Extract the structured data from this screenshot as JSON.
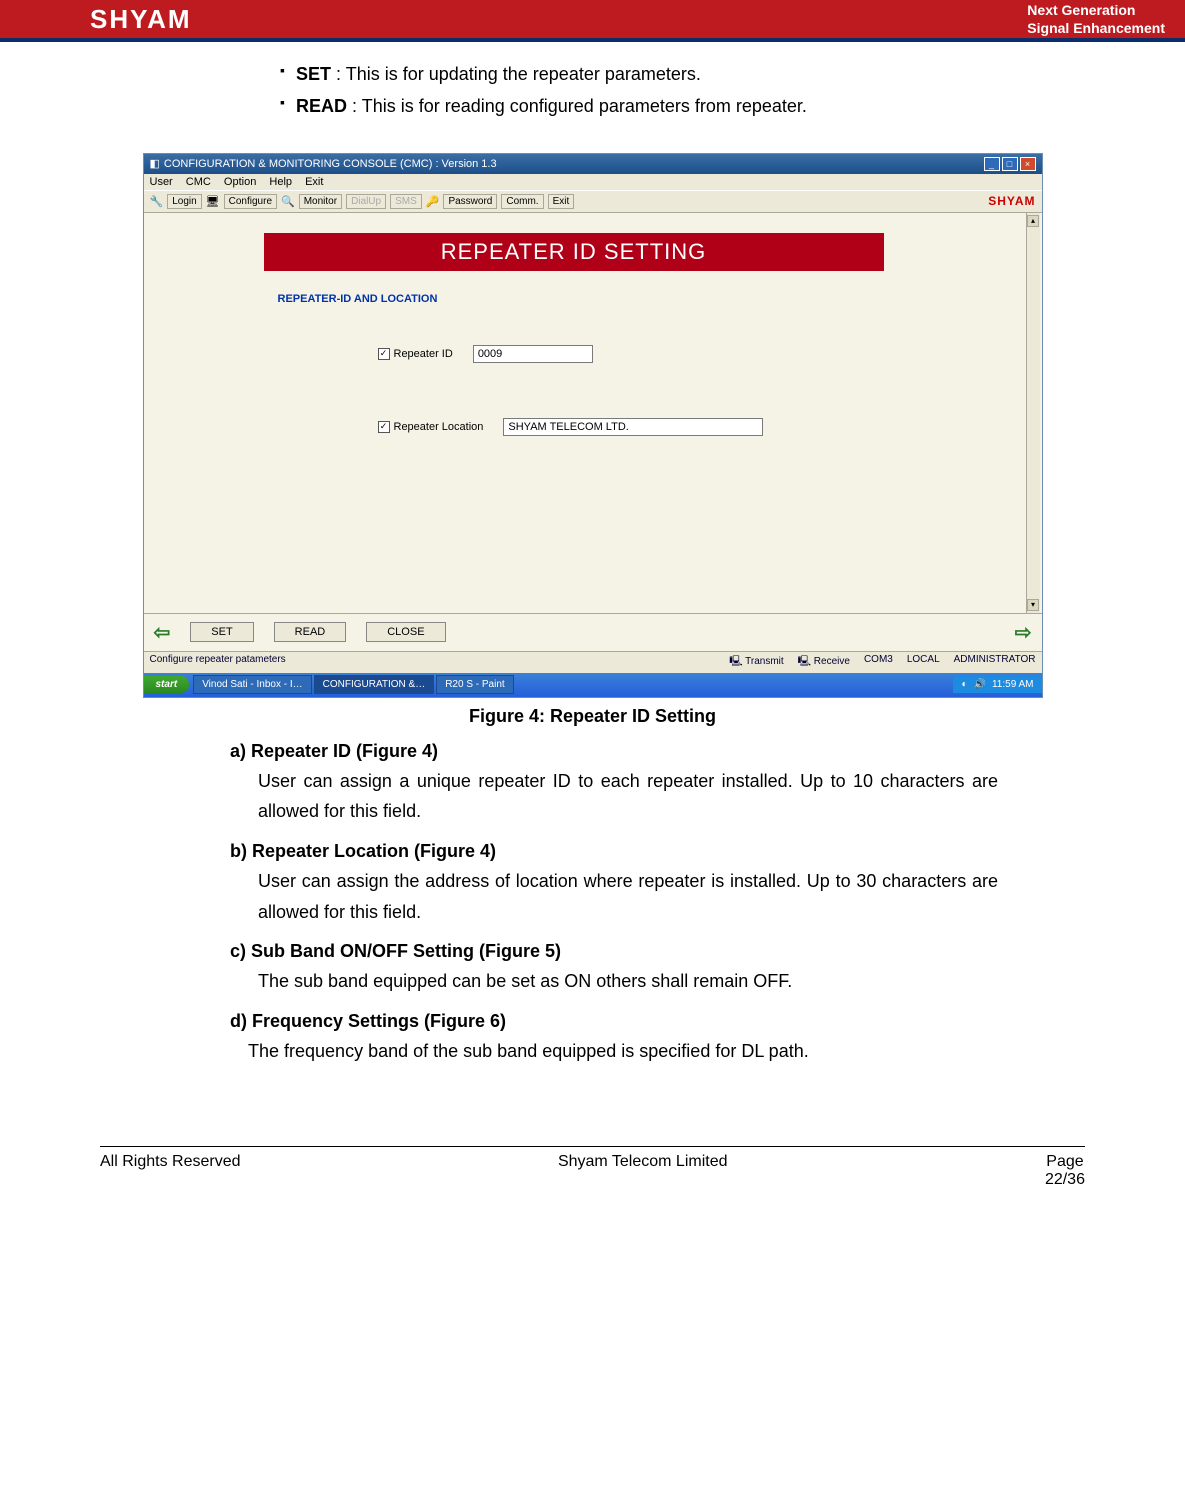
{
  "banner": {
    "logo": "SHYAM",
    "tagline1": "Next Generation",
    "tagline2": "Signal Enhancement"
  },
  "bullets": {
    "set": {
      "label": "SET",
      "desc": " : This is for updating the repeater parameters."
    },
    "read": {
      "label": "READ",
      "desc": " : This  is for reading configured parameters from repeater."
    }
  },
  "screenshot": {
    "title": "CONFIGURATION & MONITORING CONSOLE (CMC)  :  Version 1.3",
    "menus": [
      "User",
      "CMC",
      "Option",
      "Help",
      "Exit"
    ],
    "toolbar": [
      "Login",
      "Configure",
      "Monitor",
      "DialUp",
      "SMS",
      "Password",
      "Comm.",
      "Exit"
    ],
    "brand": "SHYAM",
    "panel_title": "REPEATER ID SETTING",
    "legend": "REPEATER-ID AND LOCATION",
    "field1": {
      "label": "Repeater ID",
      "value": "0009"
    },
    "field2": {
      "label": "Repeater Location",
      "value": "SHYAM TELECOM LTD."
    },
    "btn_set": "SET",
    "btn_read": "READ",
    "btn_close": "CLOSE",
    "status_left": "Configure repeater patameters",
    "status_items": [
      "Transmit",
      "Receive",
      "COM3",
      "LOCAL",
      "ADMINISTRATOR"
    ],
    "start": "start",
    "tasks": [
      "Vinod Sati - Inbox - I…",
      "CONFIGURATION &…",
      "R20 S - Paint"
    ],
    "clock": "11:59 AM"
  },
  "fig_caption": "Figure 4: Repeater ID Setting",
  "sections": {
    "a": {
      "hd": "a) Repeater ID (Figure 4)",
      "body": "User can assign a unique repeater ID to each repeater installed. Up to 10 characters are allowed for this field."
    },
    "b": {
      "hd": "b) Repeater Location (Figure 4)",
      "body": "User can assign the address of location where repeater is installed. Up to 30 characters are allowed for this field."
    },
    "c": {
      "hd": "c) Sub Band ON/OFF Setting (Figure 5)",
      "body": "The sub band equipped can be set as ON others shall remain OFF."
    },
    "d": {
      "hd": "d) Frequency Settings (Figure 6)",
      "body": "The frequency band of the sub band equipped is specified for DL path."
    }
  },
  "footer": {
    "left": "All Rights Reserved",
    "center": "Shyam Telecom Limited",
    "pg_label": "Page",
    "pg_num": "22/36"
  }
}
